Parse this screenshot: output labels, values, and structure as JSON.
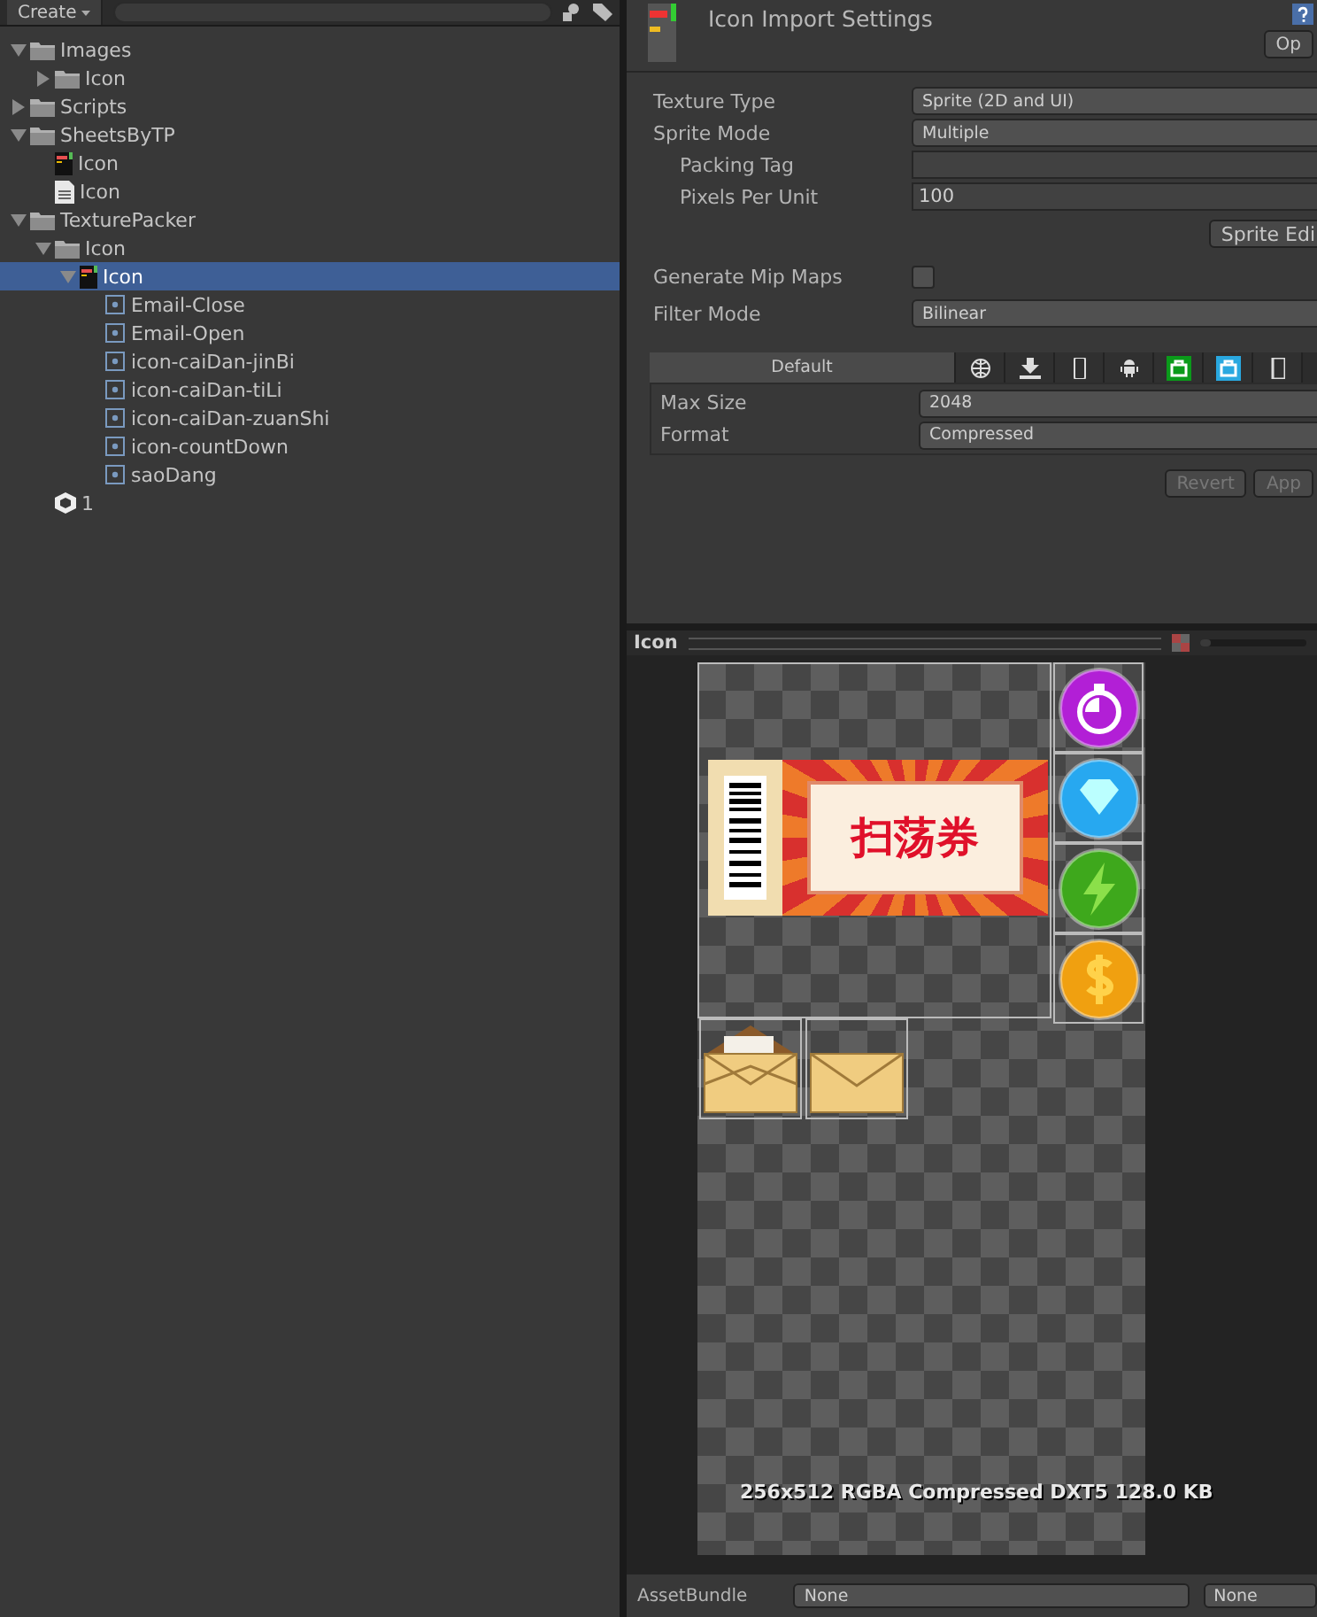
{
  "project": {
    "create_button": "Create",
    "tree": [
      {
        "label": "Images",
        "kind": "folder",
        "expanded": true,
        "selected": false,
        "children": [
          {
            "label": "Icon",
            "kind": "folder",
            "expanded": false,
            "selected": false
          }
        ]
      },
      {
        "label": "Scripts",
        "kind": "folder",
        "expanded": false,
        "selected": false
      },
      {
        "label": "SheetsByTP",
        "kind": "folder",
        "expanded": true,
        "selected": false,
        "children": [
          {
            "label": "Icon",
            "kind": "texture",
            "selected": false
          },
          {
            "label": "Icon",
            "kind": "textfile",
            "selected": false
          }
        ]
      },
      {
        "label": "TexturePacker",
        "kind": "folder",
        "expanded": true,
        "selected": false,
        "children": [
          {
            "label": "Icon",
            "kind": "folder",
            "expanded": true,
            "selected": false,
            "children": [
              {
                "label": "Icon",
                "kind": "texture",
                "expanded": true,
                "selected": true,
                "children": [
                  {
                    "label": "Email-Close",
                    "kind": "sprite",
                    "selected": false
                  },
                  {
                    "label": "Email-Open",
                    "kind": "sprite",
                    "selected": false
                  },
                  {
                    "label": "icon-caiDan-jinBi",
                    "kind": "sprite",
                    "selected": false
                  },
                  {
                    "label": "icon-caiDan-tiLi",
                    "kind": "sprite",
                    "selected": false
                  },
                  {
                    "label": "icon-caiDan-zuanShi",
                    "kind": "sprite",
                    "selected": false
                  },
                  {
                    "label": "icon-countDown",
                    "kind": "sprite",
                    "selected": false
                  },
                  {
                    "label": "saoDang",
                    "kind": "sprite",
                    "selected": false
                  }
                ]
              }
            ]
          }
        ]
      },
      {
        "label": "1",
        "kind": "scene",
        "selected": false
      }
    ]
  },
  "inspector": {
    "title": "Icon Import Settings",
    "open_button": "Op",
    "fields": [
      {
        "label": "Texture Type",
        "kind": "dropdown",
        "value": "Sprite (2D and UI)"
      },
      {
        "label": "Sprite Mode",
        "kind": "dropdown",
        "value": "Multiple"
      },
      {
        "label": "Packing Tag",
        "kind": "text",
        "indented": true
      },
      {
        "label": "Pixels Per Unit",
        "kind": "text",
        "value": "100",
        "indented": true
      },
      {
        "kind": "button",
        "value": "Sprite Edi"
      },
      {
        "label": "Generate Mip Maps",
        "kind": "checkbox",
        "checked": false
      },
      {
        "label": "Filter Mode",
        "kind": "dropdown",
        "value": "Bilinear"
      }
    ],
    "platform_tabs": [
      {
        "kind": "text",
        "label": "Default",
        "selected": true
      },
      {
        "kind": "globe",
        "selected": false
      },
      {
        "kind": "download",
        "selected": false
      },
      {
        "kind": "phone",
        "selected": false
      },
      {
        "kind": "android",
        "selected": false
      },
      {
        "kind": "xbox",
        "selected": false
      },
      {
        "kind": "store",
        "selected": false
      },
      {
        "kind": "other",
        "selected": false
      }
    ],
    "platform_fields": [
      {
        "label": "Max Size",
        "value": "2048"
      },
      {
        "label": "Format",
        "value": "Compressed"
      }
    ],
    "buttons": [
      {
        "label": "Revert",
        "disabled": true
      },
      {
        "label": "App",
        "disabled": true
      }
    ]
  },
  "preview": {
    "title": "Icon",
    "zoom_slider": {
      "level": 0
    },
    "ticket_text": "扫荡券",
    "info": "256x512  RGBA Compressed DXT5   128.0 KB"
  },
  "asset_bundle": {
    "label": "AssetBundle",
    "values": [
      "None",
      "None"
    ]
  }
}
